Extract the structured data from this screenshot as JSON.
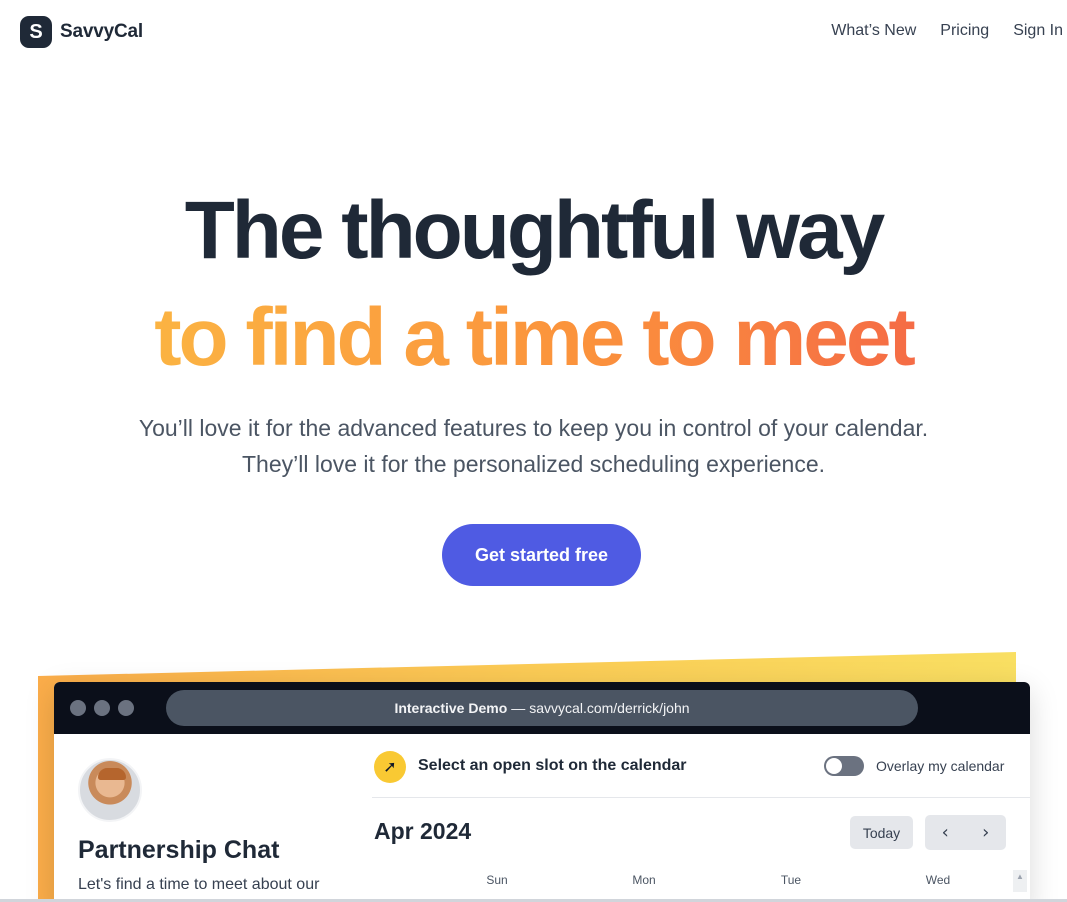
{
  "header": {
    "logo_letter": "S",
    "logo_text": "SavvyCal",
    "nav": [
      "What’s New",
      "Pricing",
      "Sign In"
    ]
  },
  "hero": {
    "line1": "The thoughtful way",
    "line2": "to find a time to meet",
    "sub1": "You’ll love it for the advanced features to keep you in control of your calendar.",
    "sub2": "They’ll love it for the personalized scheduling experience.",
    "cta": "Get started free"
  },
  "demo": {
    "url_label": "Interactive Demo",
    "url_sep": "—",
    "url": "savvycal.com/derrick/john",
    "meeting_title": "Partnership Chat",
    "meeting_desc": "Let's find a time to meet about our",
    "hint": "Select an open slot on the calendar",
    "toggle_label": "Overlay my calendar",
    "month": "Apr 2024",
    "today": "Today",
    "prev": "‹",
    "next": "›",
    "days": [
      "Sun",
      "Mon",
      "Tue",
      "Wed"
    ]
  },
  "colors": {
    "cta": "#4f5be3",
    "gradient_start": "#fbbf45",
    "gradient_end": "#f25a4a",
    "hint_icon": "#f9c933"
  }
}
